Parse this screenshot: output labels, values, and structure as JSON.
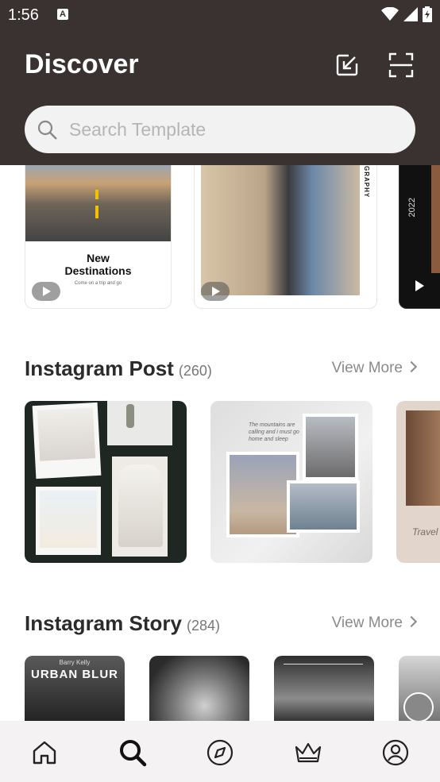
{
  "status": {
    "time": "1:56"
  },
  "header": {
    "title": "Discover"
  },
  "search": {
    "placeholder": "Search Template"
  },
  "top_cards": [
    {
      "title_line1": "New",
      "title_line2": "Destinations",
      "subtitle": "Come on a trip and go"
    },
    {
      "side_text": "GRAPHY"
    },
    {
      "year": "2022"
    }
  ],
  "sections": [
    {
      "title": "Instagram Post",
      "count": "(260)",
      "view_more": "View More"
    },
    {
      "title": "Instagram Story",
      "count": "(284)",
      "view_more": "View More"
    }
  ],
  "posts": [
    {
      "note": ""
    },
    {
      "quote": "The mountains are calling and i must go home and sleep"
    },
    {
      "text": "Travel"
    }
  ],
  "stories": [
    {
      "small": "Barry Kelly",
      "title": "URBAN BLUR"
    }
  ],
  "nav": [
    "home-icon",
    "search-icon",
    "compass-icon",
    "crown-icon",
    "profile-icon"
  ],
  "colors": {
    "header": "#3a3131",
    "accent": "#000000"
  }
}
